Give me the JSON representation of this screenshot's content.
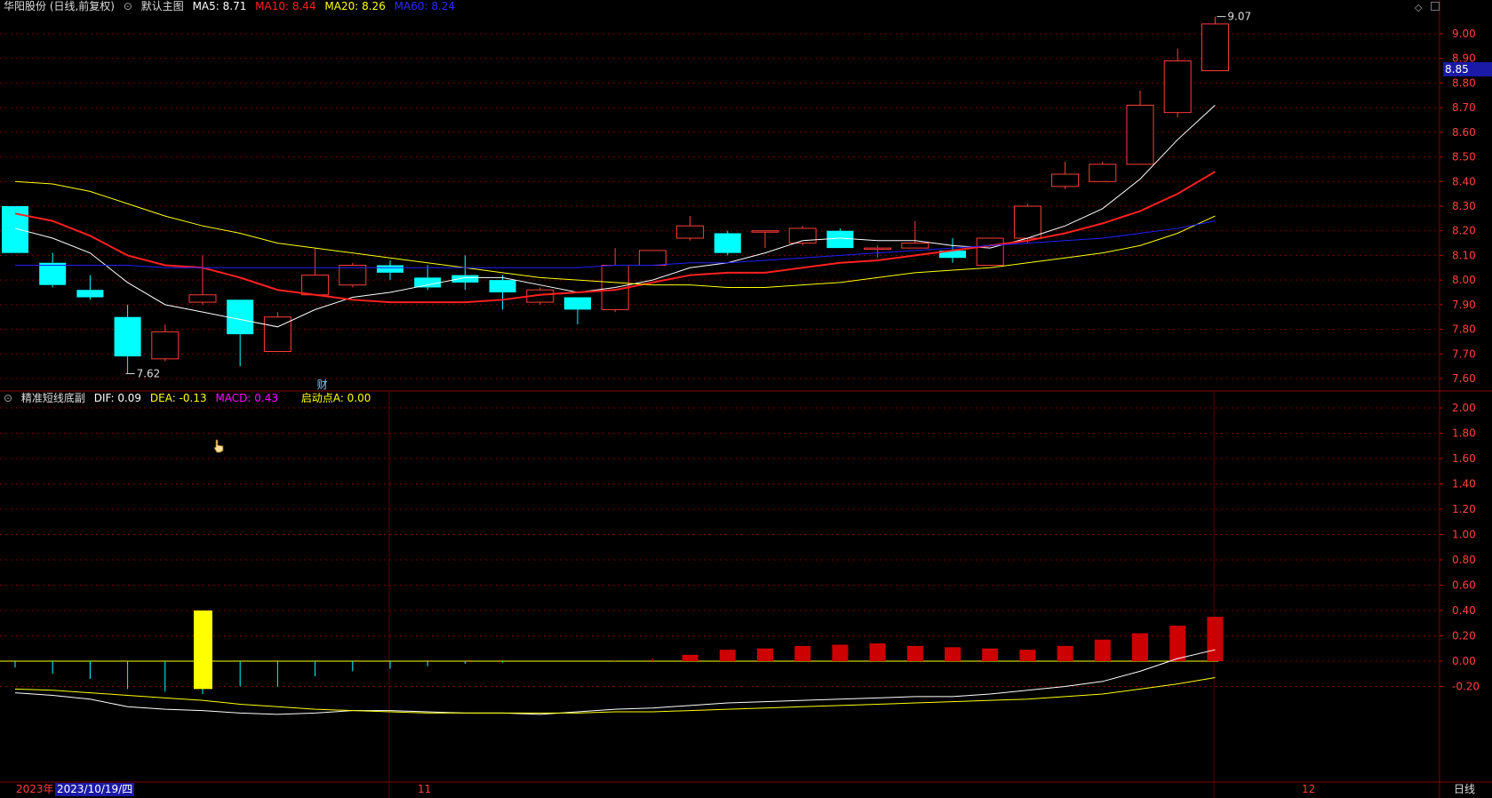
{
  "main_header": {
    "stock": "华阳股份 (日线,前复权)",
    "template": "默认主图",
    "ma5": "MA5: 8.71",
    "ma10": "MA10: 8.44",
    "ma20": "MA20: 8.26",
    "ma60": "MA60: 8.24"
  },
  "sub_header": {
    "indicator": "精准短线底副",
    "dif": "DIF: 0.09",
    "dea": "DEA: -0.13",
    "macd": "MACD: 0.43",
    "start": "启动点A: 0.00"
  },
  "current_price": "8.85",
  "bottom_bar": {
    "year": "2023年",
    "cursor_date": "2023/10/19/四",
    "nov": "11",
    "dec": "12",
    "period": "日线"
  },
  "colors": {
    "up": "#ff3b3b",
    "down": "#00ffff",
    "ma5": "#ffffff",
    "ma10": "#ff2020",
    "ma20": "#ffff00",
    "ma60": "#2020ff",
    "grid": "#7a0000",
    "dif": "#ffffff",
    "dea": "#ffff00",
    "macd_red": "#cc0000",
    "macd_cyan": "#00ffff",
    "signal": "#ffff00"
  },
  "chart_data": [
    {
      "type": "candlestick",
      "title": "华阳股份 (日线,前复权)",
      "ylim": [
        7.55,
        9.1
      ],
      "yticks": [
        "9.00",
        "8.90",
        "8.80",
        "8.70",
        "8.60",
        "8.50",
        "8.40",
        "8.30",
        "8.20",
        "8.10",
        "8.00",
        "7.90",
        "7.80",
        "7.70",
        "7.60"
      ],
      "annotations": {
        "low": "7.62",
        "high": "9.07",
        "marker": "财"
      },
      "candles": [
        {
          "o": 8.3,
          "h": 8.3,
          "l": 8.11,
          "c": 8.11
        },
        {
          "o": 8.07,
          "h": 8.11,
          "l": 7.97,
          "c": 7.98
        },
        {
          "o": 7.96,
          "h": 8.02,
          "l": 7.92,
          "c": 7.93
        },
        {
          "o": 7.85,
          "h": 7.9,
          "l": 7.62,
          "c": 7.69
        },
        {
          "o": 7.68,
          "h": 7.82,
          "l": 7.67,
          "c": 7.79
        },
        {
          "o": 7.91,
          "h": 8.1,
          "l": 7.9,
          "c": 7.94
        },
        {
          "o": 7.92,
          "h": 7.92,
          "l": 7.65,
          "c": 7.78
        },
        {
          "o": 7.71,
          "h": 7.87,
          "l": 7.71,
          "c": 7.85
        },
        {
          "o": 7.94,
          "h": 8.13,
          "l": 7.94,
          "c": 8.02
        },
        {
          "o": 7.98,
          "h": 8.07,
          "l": 7.97,
          "c": 8.06
        },
        {
          "o": 8.06,
          "h": 8.08,
          "l": 8.0,
          "c": 8.03
        },
        {
          "o": 8.01,
          "h": 8.06,
          "l": 7.96,
          "c": 7.97
        },
        {
          "o": 8.02,
          "h": 8.1,
          "l": 7.96,
          "c": 7.99
        },
        {
          "o": 8.0,
          "h": 8.02,
          "l": 7.88,
          "c": 7.95
        },
        {
          "o": 7.91,
          "h": 7.97,
          "l": 7.9,
          "c": 7.96
        },
        {
          "o": 7.93,
          "h": 7.93,
          "l": 7.82,
          "c": 7.88
        },
        {
          "o": 7.88,
          "h": 8.13,
          "l": 7.87,
          "c": 8.06
        },
        {
          "o": 8.06,
          "h": 8.12,
          "l": 8.06,
          "c": 8.12
        },
        {
          "o": 8.17,
          "h": 8.26,
          "l": 8.16,
          "c": 8.22
        },
        {
          "o": 8.19,
          "h": 8.2,
          "l": 8.1,
          "c": 8.11
        },
        {
          "o": 8.2,
          "h": 8.2,
          "l": 8.13,
          "c": 8.2
        },
        {
          "o": 8.15,
          "h": 8.22,
          "l": 8.14,
          "c": 8.21
        },
        {
          "o": 8.2,
          "h": 8.21,
          "l": 8.13,
          "c": 8.13
        },
        {
          "o": 8.13,
          "h": 8.14,
          "l": 8.09,
          "c": 8.13
        },
        {
          "o": 8.13,
          "h": 8.24,
          "l": 8.13,
          "c": 8.15
        },
        {
          "o": 8.12,
          "h": 8.17,
          "l": 8.07,
          "c": 8.09
        },
        {
          "o": 8.06,
          "h": 8.17,
          "l": 8.06,
          "c": 8.17
        },
        {
          "o": 8.17,
          "h": 8.31,
          "l": 8.15,
          "c": 8.3
        },
        {
          "o": 8.38,
          "h": 8.48,
          "l": 8.37,
          "c": 8.43
        },
        {
          "o": 8.4,
          "h": 8.48,
          "l": 8.4,
          "c": 8.47
        },
        {
          "o": 8.47,
          "h": 8.77,
          "l": 8.47,
          "c": 8.71
        },
        {
          "o": 8.68,
          "h": 8.94,
          "l": 8.66,
          "c": 8.89
        },
        {
          "o": 8.85,
          "h": 9.07,
          "l": 8.85,
          "c": 9.04
        }
      ],
      "series": [
        {
          "name": "MA5",
          "values": [
            8.21,
            8.17,
            8.11,
            7.99,
            7.9,
            7.87,
            7.84,
            7.81,
            7.88,
            7.93,
            7.95,
            7.98,
            8.01,
            8.01,
            7.98,
            7.95,
            7.97,
            8.0,
            8.05,
            8.07,
            8.11,
            8.16,
            8.17,
            8.16,
            8.16,
            8.14,
            8.13,
            8.17,
            8.22,
            8.29,
            8.41,
            8.57,
            8.71
          ]
        },
        {
          "name": "MA10",
          "values": [
            8.27,
            8.24,
            8.18,
            8.1,
            8.06,
            8.05,
            8.01,
            7.96,
            7.94,
            7.92,
            7.91,
            7.91,
            7.91,
            7.92,
            7.94,
            7.95,
            7.96,
            7.99,
            8.02,
            8.03,
            8.03,
            8.05,
            8.07,
            8.08,
            8.1,
            8.12,
            8.14,
            8.16,
            8.19,
            8.23,
            8.28,
            8.35,
            8.44
          ]
        },
        {
          "name": "MA20",
          "values": [
            8.4,
            8.39,
            8.36,
            8.31,
            8.26,
            8.22,
            8.19,
            8.15,
            8.13,
            8.11,
            8.09,
            8.07,
            8.05,
            8.03,
            8.01,
            8.0,
            7.99,
            7.98,
            7.98,
            7.97,
            7.97,
            7.98,
            7.99,
            8.01,
            8.03,
            8.04,
            8.05,
            8.07,
            8.09,
            8.11,
            8.14,
            8.19,
            8.26
          ]
        },
        {
          "name": "MA60",
          "values": [
            8.06,
            8.06,
            8.06,
            8.06,
            8.05,
            8.05,
            8.05,
            8.05,
            8.05,
            8.05,
            8.05,
            8.05,
            8.05,
            8.05,
            8.05,
            8.05,
            8.06,
            8.06,
            8.07,
            8.07,
            8.08,
            8.09,
            8.1,
            8.11,
            8.12,
            8.13,
            8.14,
            8.15,
            8.16,
            8.17,
            8.19,
            8.21,
            8.24
          ]
        }
      ]
    },
    {
      "type": "bar",
      "title": "精准短线底副",
      "ylim": [
        -0.4,
        2.1
      ],
      "yticks": [
        "2.00",
        "1.80",
        "1.60",
        "1.40",
        "1.20",
        "1.00",
        "0.80",
        "0.60",
        "0.40",
        "0.20",
        "0.00",
        "-0.20"
      ],
      "macd": [
        -0.05,
        -0.1,
        -0.14,
        -0.22,
        -0.24,
        -0.26,
        -0.2,
        -0.2,
        -0.12,
        -0.08,
        -0.06,
        -0.04,
        -0.02,
        -0.01,
        0.0,
        0.0,
        0.01,
        0.02,
        0.05,
        0.09,
        0.1,
        0.12,
        0.13,
        0.14,
        0.12,
        0.11,
        0.1,
        0.09,
        0.12,
        0.17,
        0.22,
        0.28,
        0.35,
        0.42
      ],
      "signal": [
        0,
        0,
        0,
        0,
        0,
        0.4,
        0,
        0,
        0,
        0,
        0,
        0,
        0,
        0,
        0,
        0,
        0,
        0,
        0,
        0,
        0,
        0,
        0,
        0,
        0,
        0,
        0,
        0,
        0,
        0,
        0,
        0,
        0
      ],
      "series": [
        {
          "name": "DIF",
          "values": [
            -0.25,
            -0.27,
            -0.3,
            -0.36,
            -0.38,
            -0.39,
            -0.41,
            -0.42,
            -0.41,
            -0.39,
            -0.39,
            -0.4,
            -0.41,
            -0.41,
            -0.42,
            -0.4,
            -0.38,
            -0.37,
            -0.35,
            -0.33,
            -0.32,
            -0.31,
            -0.3,
            -0.29,
            -0.28,
            -0.28,
            -0.26,
            -0.23,
            -0.2,
            -0.16,
            -0.08,
            0.02,
            0.09
          ]
        },
        {
          "name": "DEA",
          "values": [
            -0.22,
            -0.23,
            -0.25,
            -0.27,
            -0.29,
            -0.31,
            -0.34,
            -0.36,
            -0.38,
            -0.39,
            -0.4,
            -0.41,
            -0.41,
            -0.41,
            -0.41,
            -0.41,
            -0.4,
            -0.4,
            -0.39,
            -0.38,
            -0.37,
            -0.36,
            -0.35,
            -0.34,
            -0.33,
            -0.32,
            -0.31,
            -0.3,
            -0.28,
            -0.26,
            -0.22,
            -0.18,
            -0.13
          ]
        }
      ]
    }
  ]
}
